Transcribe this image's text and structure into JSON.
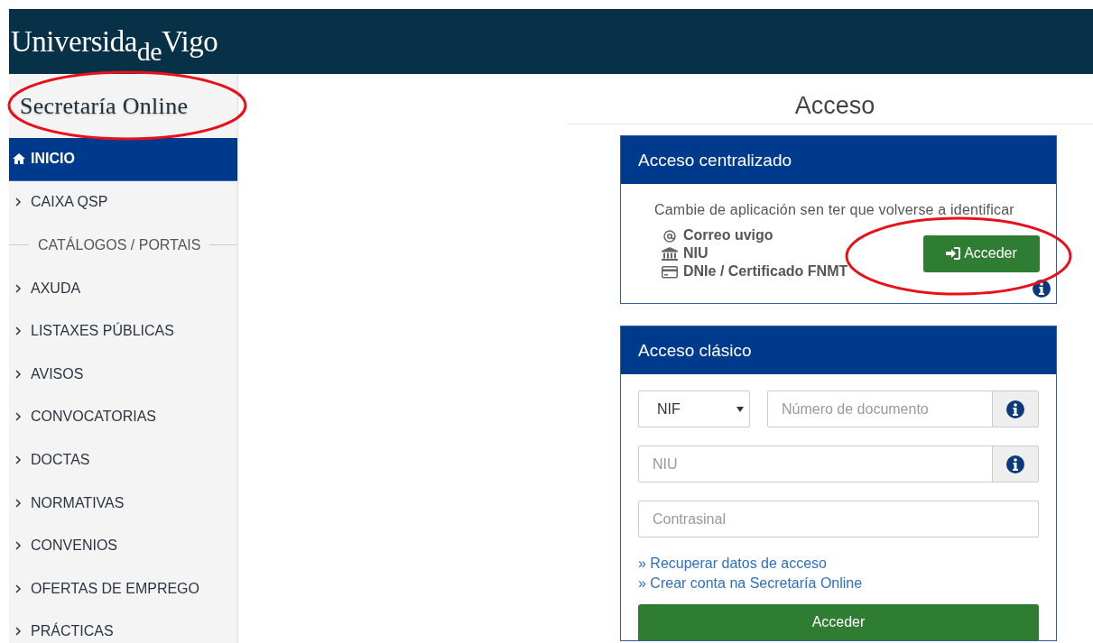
{
  "header": {
    "logo": "Universida$_{de}$Vigo"
  },
  "sidebar": {
    "title": "Secretaría Online",
    "items": [
      {
        "kind": "home",
        "label": "INICIO",
        "selected": true
      },
      {
        "kind": "link",
        "label": "CAIXA QSP",
        "selected": false
      },
      {
        "kind": "heading",
        "label": "CATÁLOGOS / PORTAIS"
      },
      {
        "kind": "link",
        "label": "AXUDA",
        "selected": false
      },
      {
        "kind": "link",
        "label": "LISTAXES PÚBLICAS",
        "selected": false
      },
      {
        "kind": "link",
        "label": "AVISOS",
        "selected": false
      },
      {
        "kind": "link",
        "label": "CONVOCATORIAS",
        "selected": false
      },
      {
        "kind": "link",
        "label": "DOCTAS",
        "selected": false
      },
      {
        "kind": "link",
        "label": "NORMATIVAS",
        "selected": false
      },
      {
        "kind": "link",
        "label": "CONVENIOS",
        "selected": false
      },
      {
        "kind": "link",
        "label": "OFERTAS DE EMPREGO",
        "selected": false
      },
      {
        "kind": "link",
        "label": "PRÁCTICAS",
        "selected": false
      }
    ]
  },
  "page_title": "Acceso",
  "centralized": {
    "title": "Acceso centralizado",
    "description": "Cambie de aplicación sen ter que volverse a identificar",
    "methods": [
      {
        "kind": "email",
        "label": "Correo uvigo"
      },
      {
        "kind": "bank",
        "label": "NIU"
      },
      {
        "kind": "card",
        "label": "DNIe / Certificado FNMT"
      }
    ],
    "button": "Acceder"
  },
  "classic": {
    "title": "Acceso clásico",
    "document_type": "NIF",
    "document_placeholder": "Número de documento",
    "niu_placeholder": "NIU",
    "password_placeholder": "Contrasinal",
    "links": [
      "» Recuperar datos de acceso",
      "» Crear conta na Secretaría Online"
    ],
    "button": "Acceder"
  },
  "annotations": [
    {
      "kind": "ellipse"
    },
    {
      "kind": "ellipse"
    }
  ]
}
